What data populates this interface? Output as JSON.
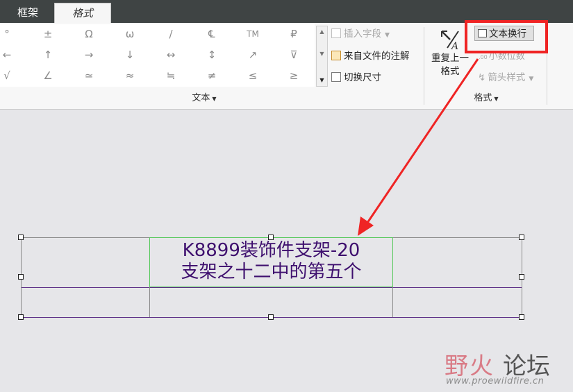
{
  "tabs": [
    {
      "label": "框架"
    },
    {
      "label": "格式"
    }
  ],
  "symbols": [
    [
      "°",
      "±",
      "Ω",
      "ω",
      "/",
      "℄",
      "TM",
      "₽"
    ],
    [
      "←",
      "↑",
      "→",
      "↓",
      "↔",
      "↕",
      "↗",
      "⊽"
    ],
    [
      "√",
      "∠",
      "≃",
      "≈",
      "≒",
      "≠",
      "≤",
      "≥"
    ]
  ],
  "text_group": {
    "insert_field": "插入字段",
    "note_from_file": "来自文件的注解",
    "toggle_dimension": "切换尺寸",
    "label": "文本"
  },
  "format_group": {
    "repeat_last": [
      "重复上一",
      "格式"
    ],
    "text_wrap": "文本换行",
    "decimal_places": "小数位数",
    "arrow_style": "箭头样式",
    "label": "格式"
  },
  "table": {
    "cell_text": [
      "K8899装饰件支架-20",
      "支架之十二中的第五个"
    ]
  },
  "watermark": {
    "name_a": "野火",
    "name_b": "论坛",
    "url": "www.proewildfire.cn"
  },
  "colors": {
    "highlight_box": "#ef2424",
    "arrow": "#ef2424",
    "cell_text": "#3e0f6e",
    "selection": "#55c85a"
  }
}
